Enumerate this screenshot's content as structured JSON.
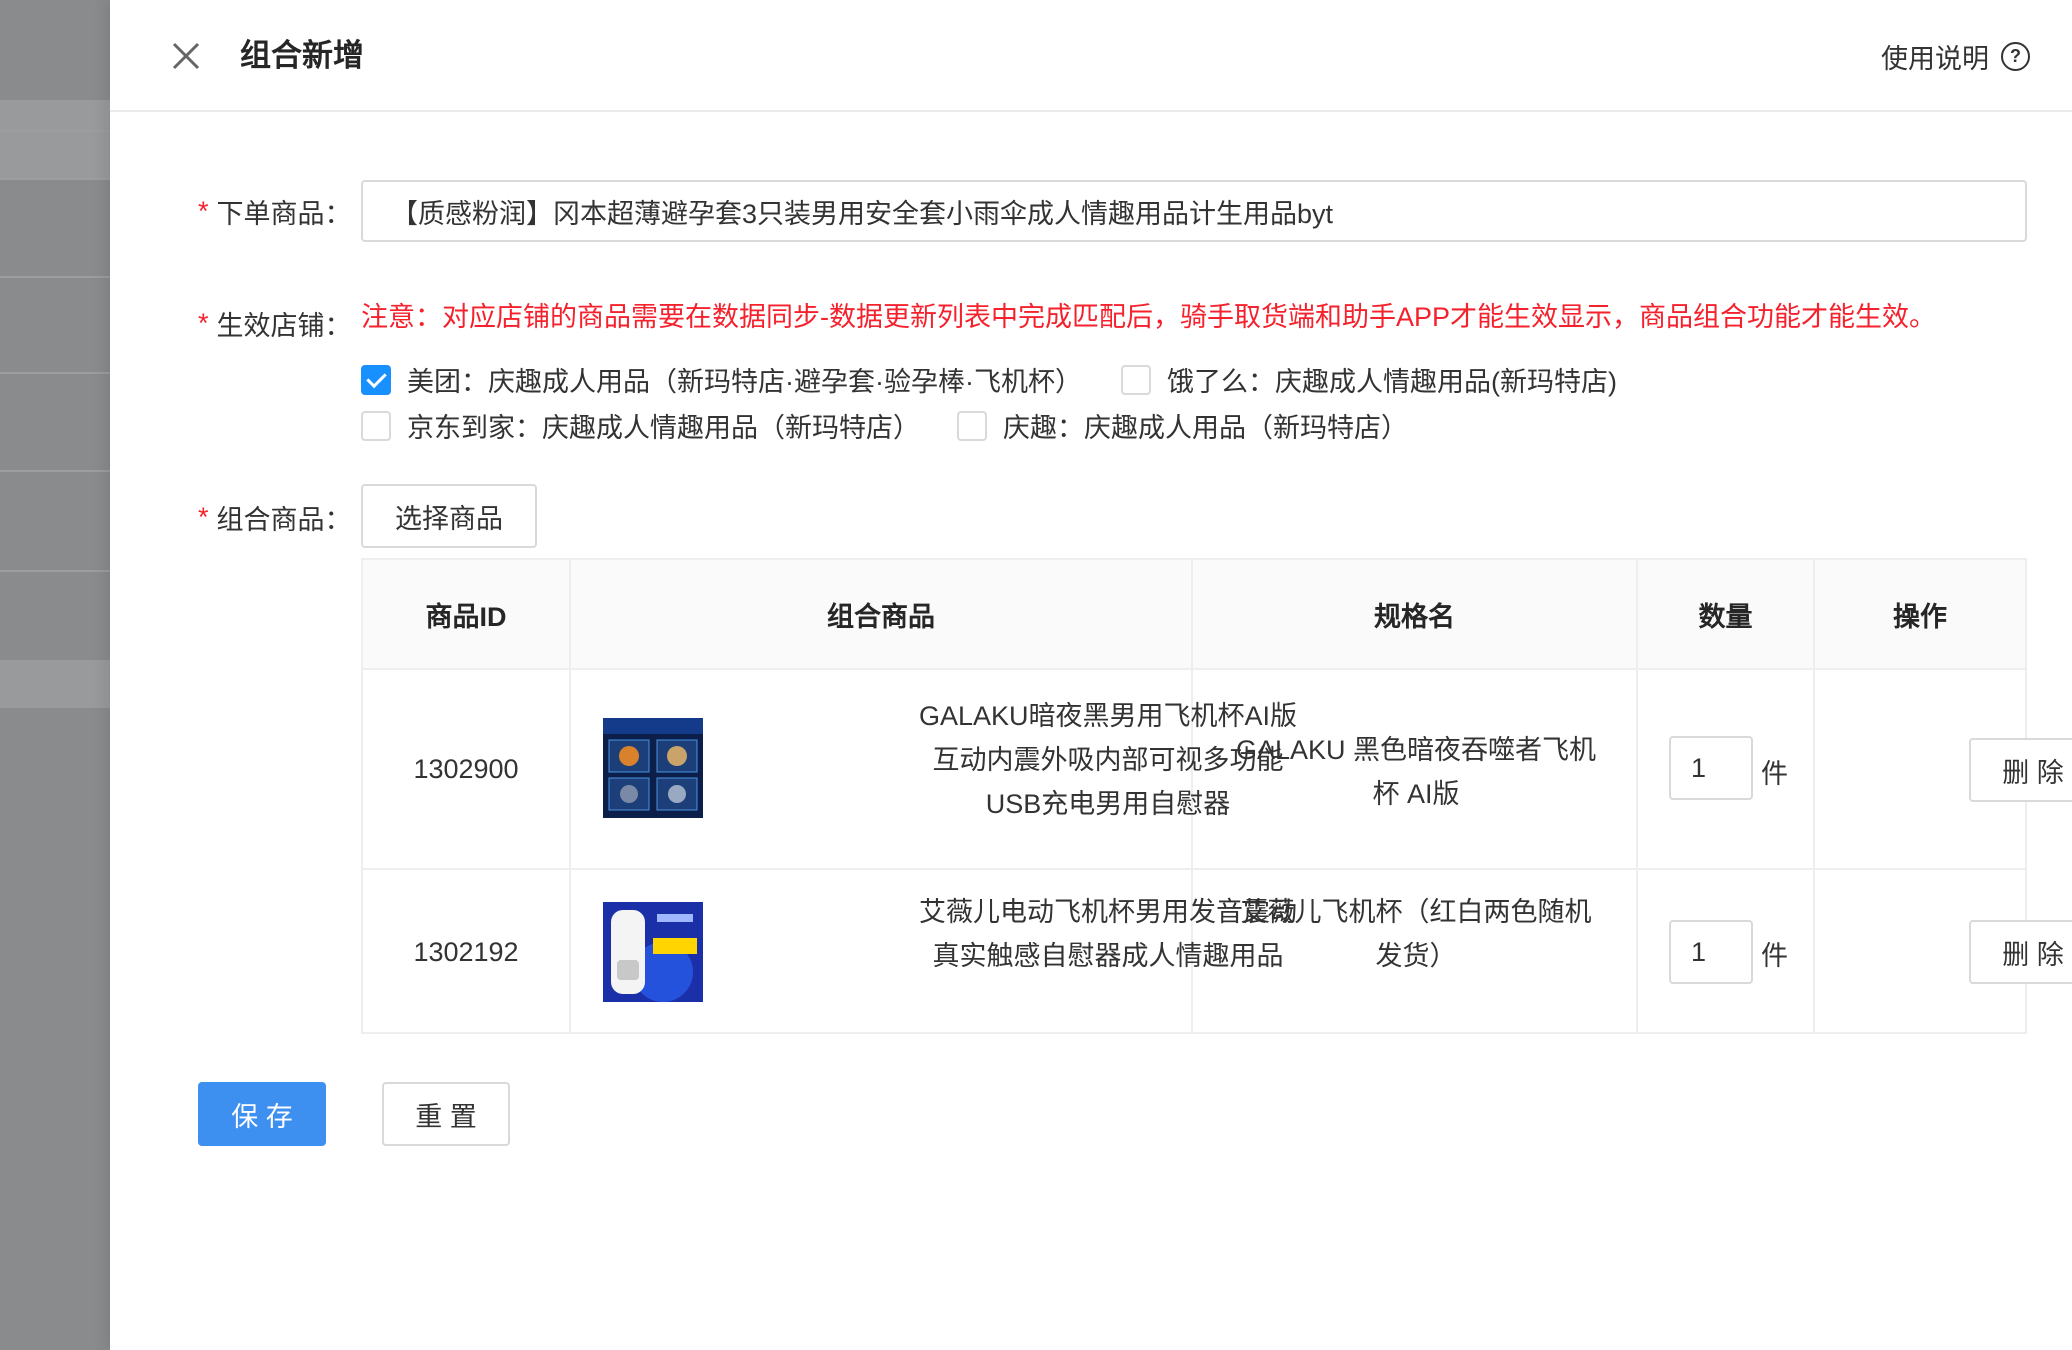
{
  "drawer": {
    "title": "组合新增",
    "help_label": "使用说明",
    "help_icon": "question-circle-icon",
    "close_icon": "close-icon"
  },
  "form": {
    "order_product": {
      "label": "下单商品：",
      "value": "【质感粉润】冈本超薄避孕套3只装男用安全套小雨伞成人情趣用品计生用品byt"
    },
    "stores": {
      "label": "生效店铺：",
      "notice": "注意：对应店铺的商品需要在数据同步-数据更新列表中完成匹配后，骑手取货端和助手APP才能生效显示，商品组合功能才能生效。",
      "options": [
        {
          "label": "美团：庆趣成人用品（新玛特店·避孕套·验孕棒·飞机杯）",
          "checked": true
        },
        {
          "label": "饿了么：庆趣成人情趣用品(新玛特店)",
          "checked": false
        },
        {
          "label": "京东到家：庆趣成人情趣用品（新玛特店）",
          "checked": false
        },
        {
          "label": "庆趣：庆趣成人用品（新玛特店）",
          "checked": false
        }
      ]
    },
    "combo": {
      "label": "组合商品：",
      "select_button": "选择商品",
      "columns": [
        "商品ID",
        "组合商品",
        "规格名",
        "数量",
        "操作"
      ],
      "rows": [
        {
          "id": "1302900",
          "name_lines": [
            "GALAKU暗夜黑男用飞机杯AI版",
            "互动内震外吸内部可视多功能",
            "USB充电男用自慰器"
          ],
          "spec_lines": [
            "GALAKU 黑色暗夜吞噬者飞机",
            "杯 AI版"
          ],
          "qty": "1",
          "unit": "件",
          "action": "删 除",
          "thumb_icon": "product-thumbnail"
        },
        {
          "id": "1302192",
          "name_lines": [
            "艾薇儿电动飞机杯男用发音震动",
            "真实触感自慰器成人情趣用品"
          ],
          "spec_lines": [
            "艾薇儿飞机杯（红白两色随机",
            "发货）"
          ],
          "qty": "1",
          "unit": "件",
          "action": "删 除",
          "thumb_icon": "product-thumbnail"
        }
      ]
    },
    "save_label": "保 存",
    "reset_label": "重 置"
  }
}
